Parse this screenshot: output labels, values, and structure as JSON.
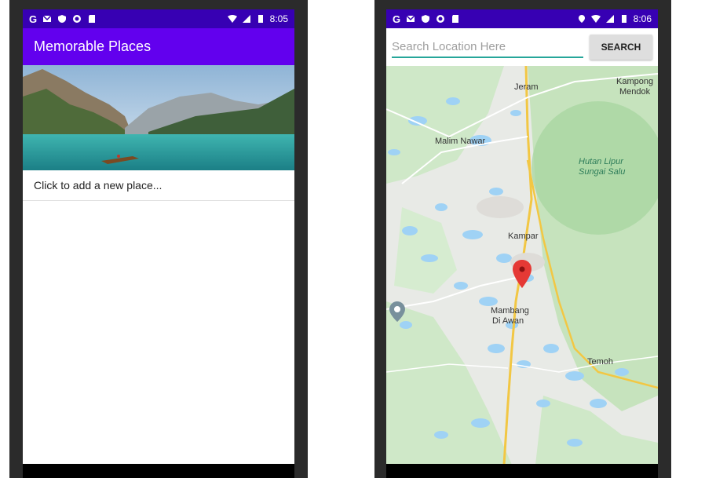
{
  "left_screen": {
    "status": {
      "time": "8:05"
    },
    "app_title": "Memorable Places",
    "list_items": [
      "Click to add a new place..."
    ]
  },
  "right_screen": {
    "status": {
      "time": "8:06"
    },
    "search": {
      "placeholder": "Search Location Here",
      "value": ""
    },
    "search_button_label": "SEARCH",
    "map_labels": {
      "jeram": "Jeram",
      "kampong_mendok_1": "Kampong",
      "kampong_mendok_2": "Mendok",
      "malim_nawar": "Malim Nawar",
      "hutan_1": "Hutan Lipur",
      "hutan_2": "Sungai Salu",
      "kampar": "Kampar",
      "mambang_1": "Mambang",
      "mambang_2": "Di Awan",
      "temoh": "Temoh"
    }
  },
  "colors": {
    "status_bar": "#3700b3",
    "app_bar": "#6200ee",
    "search_underline": "#26a69a",
    "marker": "#e53935"
  }
}
